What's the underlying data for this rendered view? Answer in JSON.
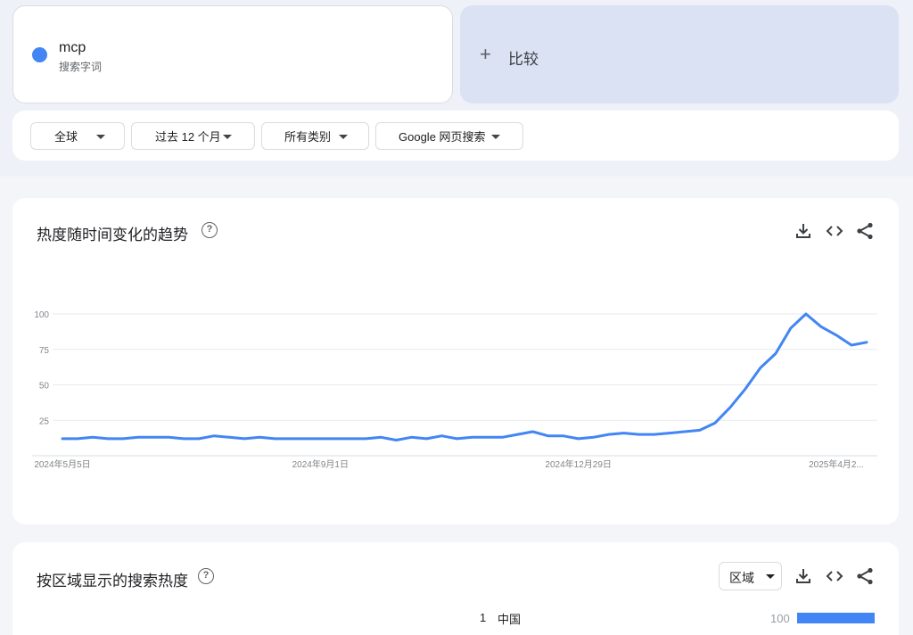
{
  "search_term": {
    "name": "mcp",
    "type": "搜索字词",
    "color": "#4285f4"
  },
  "compare": {
    "plus": "+",
    "label": "比较"
  },
  "filters": {
    "region": "全球",
    "time_range": "过去 12 个月",
    "category": "所有类别",
    "search_type": "Google 网页搜索"
  },
  "interest_over_time": {
    "title": "热度随时间变化的趋势",
    "help": "?",
    "tools": [
      "download-icon",
      "embed-icon",
      "share-icon"
    ]
  },
  "chart_data": {
    "type": "line",
    "ylim": [
      0,
      100
    ],
    "y_ticks": [
      "100",
      "75",
      "50",
      "25"
    ],
    "x_tick_labels": [
      "2024年5月5日",
      "2024年9月1日",
      "2024年12月29日",
      "2025年4月2..."
    ],
    "x_tick_indices": [
      0,
      17,
      34,
      51
    ],
    "series": [
      {
        "color": "#4285f4",
        "values": [
          12,
          12,
          13,
          12,
          12,
          13,
          13,
          13,
          12,
          12,
          14,
          13,
          12,
          13,
          12,
          12,
          12,
          12,
          12,
          12,
          12,
          13,
          11,
          13,
          12,
          14,
          12,
          13,
          13,
          13,
          15,
          17,
          14,
          14,
          12,
          13,
          15,
          16,
          15,
          15,
          16,
          17,
          18,
          23,
          34,
          47,
          62,
          72,
          90,
          100,
          91,
          85,
          78,
          80
        ]
      }
    ]
  },
  "interest_by_region": {
    "title": "按区域显示的搜索热度",
    "help": "?",
    "region_select": "区域",
    "tools": [
      "download-icon",
      "embed-icon",
      "share-icon"
    ],
    "rows": [
      {
        "rank": "1",
        "name": "中国",
        "value": "100",
        "fraction": 1.0
      }
    ]
  }
}
